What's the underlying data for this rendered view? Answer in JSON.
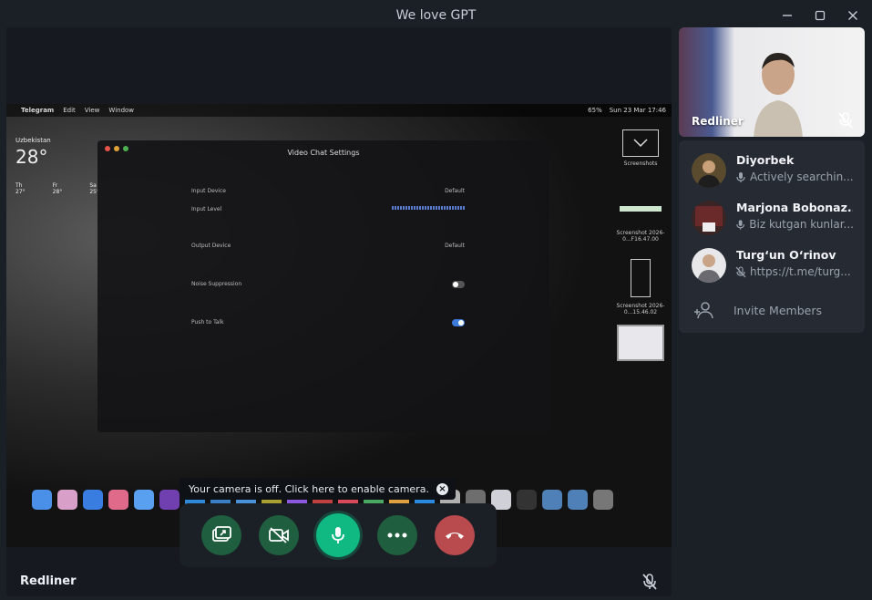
{
  "window": {
    "title": "We love GPT",
    "controls": [
      "minimize",
      "maximize",
      "close"
    ]
  },
  "shared_screen": {
    "menubar": {
      "app": "Telegram",
      "items": [
        "Edit",
        "View",
        "Window"
      ],
      "clock": "Sun 23 Mar  17:46",
      "battery": "65%"
    },
    "weather": {
      "city": "Uzbekistan",
      "temp": "28°",
      "days": [
        {
          "label": "Th",
          "temp": "27°"
        },
        {
          "label": "Fr",
          "temp": "28°"
        },
        {
          "label": "Sa",
          "temp": "25°"
        }
      ]
    },
    "settings_window": {
      "title": "Video Chat Settings",
      "rows": [
        {
          "label": "Input Device",
          "value": "Default"
        },
        {
          "label": "Input Level",
          "value": ""
        },
        {
          "label": "Output Device",
          "value": "Default"
        },
        {
          "label": "Noise Suppression",
          "value": ""
        },
        {
          "label": "Push to Talk",
          "value": ""
        }
      ]
    },
    "desktop_files": [
      {
        "label": "Screenshots"
      },
      {
        "label": "Screenshot 2026-0...F16.47.00"
      },
      {
        "label": "Screenshot 2026-0...15.46.02"
      }
    ]
  },
  "toast": {
    "text": "Your camera is off. Click here to enable camera.",
    "close_icon": "close-circle-icon"
  },
  "call_controls": [
    {
      "name": "screen-share-button",
      "icon": "screen-share-icon",
      "color": "#1f5e3e"
    },
    {
      "name": "camera-button",
      "icon": "video-off-icon",
      "color": "#1f5e3e"
    },
    {
      "name": "microphone-button",
      "icon": "microphone-icon",
      "color": "#10b981"
    },
    {
      "name": "more-button",
      "icon": "more-dots-icon",
      "color": "#1f5e3e"
    },
    {
      "name": "end-call-button",
      "icon": "phone-hangup-icon",
      "color": "#b94a4e"
    }
  ],
  "stage": {
    "speaker_name": "Redliner",
    "muted_icon": "mic-off-icon"
  },
  "self_view": {
    "name": "Redliner",
    "muted_icon": "mic-off-icon"
  },
  "members": [
    {
      "name": "Diyorbek",
      "status": "Actively searchin...",
      "status_icon": "microphone-icon"
    },
    {
      "name": "Marjona Bobonaz...",
      "status": "Biz kutgan kunlar...",
      "status_icon": "microphone-icon"
    },
    {
      "name": "Turg‘un O‘rinov",
      "status": "https://t.me/turg...",
      "status_icon": "mic-off-icon"
    }
  ],
  "invite": {
    "label": "Invite Members",
    "icon": "add-user-icon"
  },
  "colors": {
    "background": "#1b1f26",
    "panel": "#252a33",
    "accent_green": "#10b981",
    "end_call_red": "#b94a4e"
  }
}
